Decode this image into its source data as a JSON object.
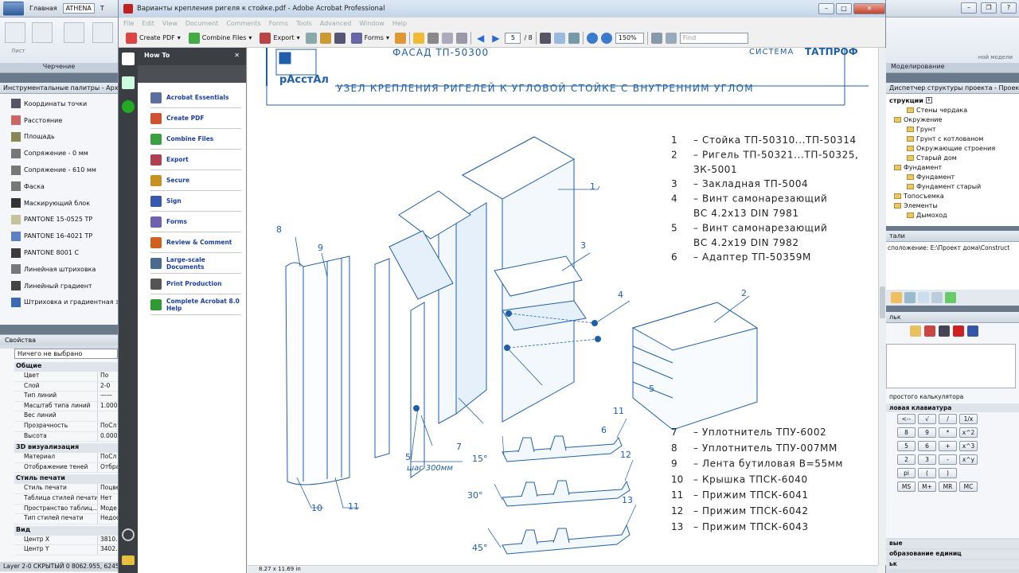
{
  "cad_left": {
    "tabs": [
      "Главная",
      "ATHENA",
      "Т"
    ],
    "ribbon_panel_title": "Черчение",
    "ribbon_small_labels": [
      "Лист"
    ],
    "palette_title": "Инструментальные палитры - Архи",
    "palette_items": [
      "Координаты точки",
      "Расстояние",
      "Площадь",
      "Сопряжение - 0 мм",
      "Сопряжение - 610 мм",
      "Фаска",
      "Маскирующий блок",
      "PANTONE 15-0525 TP",
      "PANTONE 16-4021 TP",
      "PANTONE 8001 C",
      "Линейная штриховка",
      "Линейный градиент",
      "Штриховка и градиентная зали"
    ],
    "properties_title": "Свойства",
    "selection": "Ничего не выбрано",
    "sections": [
      {
        "title": "Общие",
        "rows": [
          [
            "Цвет",
            "По"
          ],
          [
            "Слой",
            "2-0"
          ],
          [
            "Тип линий",
            "——"
          ],
          [
            "Масштаб типа линий",
            "1.000"
          ],
          [
            "Вес линий",
            ""
          ],
          [
            "Прозрачность",
            "ПоСл"
          ],
          [
            "Высота",
            "0.000"
          ]
        ]
      },
      {
        "title": "3D визуализация",
        "rows": [
          [
            "Материал",
            "ПоСл"
          ],
          [
            "Отображение теней",
            "Отбра"
          ]
        ]
      },
      {
        "title": "Стиль печати",
        "rows": [
          [
            "Стиль печати",
            "Поцвет"
          ],
          [
            "Таблица стилей печати",
            "Нет"
          ],
          [
            "Пространство таблиц...",
            "Моде"
          ],
          [
            "Тип стилей печати",
            "Недос"
          ]
        ]
      },
      {
        "title": "Вид",
        "rows": [
          [
            "Центр X",
            "3810.8"
          ],
          [
            "Центр Y",
            "3402.8"
          ]
        ]
      }
    ],
    "status": "Layer 2-0 СКРЫТЫЙ 0   8062.955, 6245"
  },
  "cad_right": {
    "ribbon_labels": [
      "Моделирование"
    ],
    "ribbon_small": "ной модели",
    "nav_title": "Диспетчер структуры проекта - Проек...",
    "tree_header": "струкции",
    "tree": [
      {
        "label": "Стены чердака",
        "level": 2
      },
      {
        "label": "Окружение",
        "level": 1
      },
      {
        "label": "Грунт",
        "level": 2
      },
      {
        "label": "Грунт с котлованом",
        "level": 2
      },
      {
        "label": "Окружающие строения",
        "level": 2
      },
      {
        "label": "Старый дом",
        "level": 2
      },
      {
        "label": "Фундамент",
        "level": 1
      },
      {
        "label": "Фундамент",
        "level": 2
      },
      {
        "label": "Фундамент старый",
        "level": 2
      },
      {
        "label": "Топосъемка",
        "level": 1
      },
      {
        "label": "Элементы",
        "level": 1
      },
      {
        "label": "Дымоход",
        "level": 2
      }
    ],
    "details_title": "тали",
    "details_path": "сположение: E:\\Проект дома\\Construct",
    "calc_title": "льк",
    "calc_subtitle": "простого калькулятора",
    "calc_panel": "ловая клавиатура",
    "calc_keys": [
      [
        "<--",
        "√",
        "/",
        "1/x"
      ],
      [
        "8",
        "9",
        "*",
        "x^2"
      ],
      [
        "5",
        "6",
        "+",
        "x^3"
      ],
      [
        "2",
        "3",
        "-",
        "x^y"
      ],
      [
        "pi",
        "(",
        ")"
      ],
      [
        "MS",
        "M+",
        "MR",
        "MC"
      ]
    ],
    "bottom_labels": [
      "вые",
      "образование единиц",
      "ьк"
    ]
  },
  "acrobat": {
    "title": "Варианты крепления ригеля к стойке.pdf - Adobe Acrobat Professional",
    "menu": [
      "File",
      "Edit",
      "View",
      "Document",
      "Comments",
      "Forms",
      "Tools",
      "Advanced",
      "Window",
      "Help"
    ],
    "toolbar": {
      "create_pdf": "Create PDF",
      "combine": "Combine Files",
      "export": "Export",
      "forms": "Forms",
      "page_current": "5",
      "page_total": "/ 8",
      "zoom": "150%",
      "find_placeholder": "Find"
    },
    "howto_title": "How To",
    "howto_items": [
      "Acrobat Essentials",
      "Create PDF",
      "Combine Files",
      "Export",
      "Secure",
      "Sign",
      "Forms",
      "Review & Comment",
      "Large-scale Documents",
      "Print Production",
      "Complete Acrobat 8.0 Help"
    ],
    "page_size": "8.27 x 11.69 in",
    "colors": {
      "drawing": "#1f5faa",
      "howto_link": "#1b3fa8",
      "titlebar": "#c8d8ec"
    }
  },
  "document": {
    "brand": "рАсстАл",
    "header_left": "ФАСАД ТП-50300",
    "header_right": "СИСТЕМА",
    "header_logo": "ТАТПРОФ",
    "subtitle": "УЗЕЛ КРЕПЛЕНИЯ РИГЕЛЕЙ К УГЛОВОЙ СТОЙКЕ С ВНУТРЕННИМ УГЛОМ",
    "legend_top": [
      {
        "n": "1",
        "text": "– Стойка ТП-50310...ТП-50314"
      },
      {
        "n": "2",
        "text": "– Ригель ТП-50321...ТП-50325,"
      },
      {
        "n": "",
        "text": "ЗК-5001"
      },
      {
        "n": "3",
        "text": "– Закладная ТП-5004"
      },
      {
        "n": "4",
        "text": "– Винт самонарезающий"
      },
      {
        "n": "",
        "text": "ВС 4.2х13 DIN 7981"
      },
      {
        "n": "5",
        "text": "– Винт самонарезающий"
      },
      {
        "n": "",
        "text": "ВС 4.2х19 DIN 7982"
      },
      {
        "n": "6",
        "text": "– Адаптер ТП-50359М"
      }
    ],
    "legend_bottom": [
      {
        "n": "7",
        "text": "– Уплотнитель ТПУ-6002"
      },
      {
        "n": "8",
        "text": "– Уплотнитель ТПУ-007ММ"
      },
      {
        "n": "9",
        "text": "– Лента бутиловая В=55мм"
      },
      {
        "n": "10",
        "text": "– Крышка ТПСК-6040"
      },
      {
        "n": "11",
        "text": "– Прижим ТПСК-6041"
      },
      {
        "n": "12",
        "text": "– Прижим ТПСК-6042"
      },
      {
        "n": "13",
        "text": "– Прижим ТПСК-6043"
      }
    ],
    "callouts": [
      "1",
      "2",
      "3",
      "4",
      "5",
      "6",
      "7",
      "8",
      "9",
      "10",
      "11",
      "5",
      "11",
      "12",
      "13"
    ],
    "step_label": "шаг 300мм",
    "angles": [
      "15°",
      "30°",
      "45°"
    ]
  }
}
